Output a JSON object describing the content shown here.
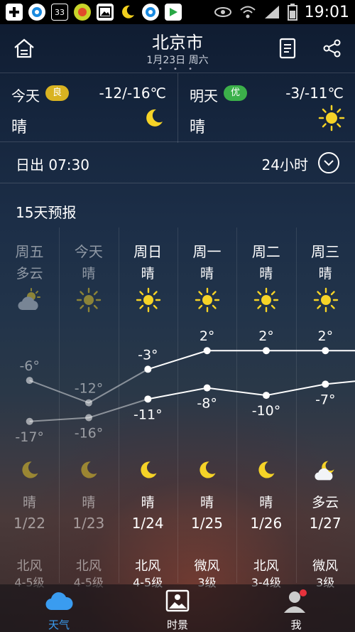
{
  "status_bar": {
    "time": "19:01",
    "notif_count": "33"
  },
  "header": {
    "city": "北京市",
    "date": "1月23日 周六",
    "page_dots": "• • •"
  },
  "today": {
    "name": "今天",
    "aqi": "良",
    "aqi_color": "#d9b321",
    "range": "-12/-16℃",
    "condition": "晴",
    "icon": "moon-icon"
  },
  "tomorrow": {
    "name": "明天",
    "aqi": "优",
    "aqi_color": "#3cb04a",
    "range": "-3/-11℃",
    "condition": "晴",
    "icon": "sun-icon"
  },
  "sunrise": "日出 07:30",
  "hours_label": "24小时",
  "forecast_title": "15天预报",
  "forecast": [
    {
      "day": "周五",
      "cond": "多云",
      "icon": "cloud-sun-icon",
      "high": "-6°",
      "low": "-17°",
      "night_icon": "moon-icon",
      "night_cond": "晴",
      "date": "1/22",
      "wind": "北风",
      "wind_level": "4-5级"
    },
    {
      "day": "今天",
      "cond": "晴",
      "icon": "sun-icon",
      "high": "-12°",
      "low": "-16°",
      "night_icon": "moon-icon",
      "night_cond": "晴",
      "date": "1/23",
      "wind": "北风",
      "wind_level": "4-5级"
    },
    {
      "day": "周日",
      "cond": "晴",
      "icon": "sun-icon",
      "high": "-3°",
      "low": "-11°",
      "night_icon": "moon-icon",
      "night_cond": "晴",
      "date": "1/24",
      "wind": "北风",
      "wind_level": "4-5级"
    },
    {
      "day": "周一",
      "cond": "晴",
      "icon": "sun-icon",
      "high": "2°",
      "low": "-8°",
      "night_icon": "moon-icon",
      "night_cond": "晴",
      "date": "1/25",
      "wind": "微风",
      "wind_level": "3级"
    },
    {
      "day": "周二",
      "cond": "晴",
      "icon": "sun-icon",
      "high": "2°",
      "low": "-10°",
      "night_icon": "moon-icon",
      "night_cond": "晴",
      "date": "1/26",
      "wind": "北风",
      "wind_level": "3-4级"
    },
    {
      "day": "周三",
      "cond": "晴",
      "icon": "sun-icon",
      "high": "2°",
      "low": "-7°",
      "night_icon": "moon-cloud-icon",
      "night_cond": "多云",
      "date": "1/27",
      "wind": "微风",
      "wind_level": "3级"
    }
  ],
  "chart_data": {
    "type": "line",
    "x": [
      "1/22",
      "1/23",
      "1/24",
      "1/25",
      "1/26",
      "1/27"
    ],
    "series": [
      {
        "values": [
          -6,
          -12,
          -3,
          2,
          2,
          2
        ]
      },
      {
        "values": [
          -17,
          -16,
          -11,
          -8,
          -10,
          -7
        ]
      }
    ],
    "ylim": [
      -18,
      3
    ]
  },
  "nav": [
    {
      "label": "天气",
      "icon": "cloud-icon",
      "active": true
    },
    {
      "label": "时景",
      "icon": "photo-icon",
      "active": false
    },
    {
      "label": "我",
      "icon": "person-icon",
      "active": false
    }
  ]
}
